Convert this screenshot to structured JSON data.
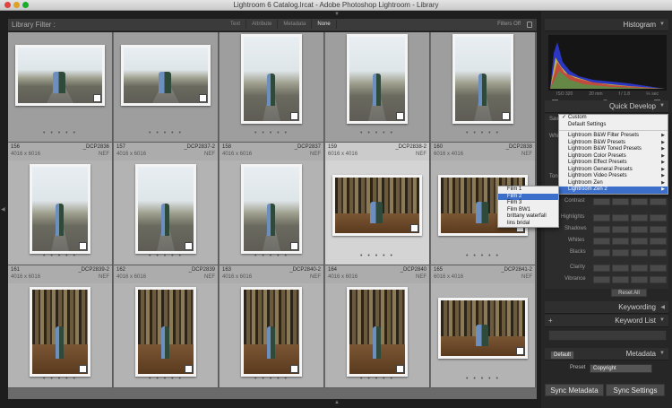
{
  "window": {
    "title": "Lightroom 6 Catalog.lrcat - Adobe Photoshop Lightroom - Library"
  },
  "library_filter": {
    "title": "Library Filter :",
    "tabs": [
      "Text",
      "Attribute",
      "Metadata",
      "None"
    ],
    "active_tab": "None",
    "filters_status": "Filters Off"
  },
  "grid": {
    "cells": [
      {
        "num": "",
        "name": "",
        "dims": "",
        "type": "",
        "photo": "road",
        "orient": "land",
        "style": "dark"
      },
      {
        "num": "",
        "name": "",
        "dims": "",
        "type": "",
        "photo": "road",
        "orient": "land",
        "style": "dark"
      },
      {
        "num": "",
        "name": "",
        "dims": "",
        "type": "",
        "photo": "road",
        "orient": "port",
        "style": "dark"
      },
      {
        "num": "",
        "name": "",
        "dims": "",
        "type": "",
        "photo": "road",
        "orient": "port",
        "style": "dark"
      },
      {
        "num": "",
        "name": "",
        "dims": "",
        "type": "",
        "photo": "road",
        "orient": "port",
        "style": "dark"
      },
      {
        "num": "156",
        "name": "_DCP2836",
        "dims": "4016 x 6016",
        "type": "NEF",
        "photo": "road",
        "orient": "port",
        "style": "light"
      },
      {
        "num": "157",
        "name": "_DCP2837-2",
        "dims": "4016 x 6016",
        "type": "NEF",
        "photo": "road",
        "orient": "port",
        "style": "light"
      },
      {
        "num": "158",
        "name": "_DCP2837",
        "dims": "4016 x 6016",
        "type": "NEF",
        "photo": "road",
        "orient": "port",
        "style": "light"
      },
      {
        "num": "159",
        "name": "_DCP2838-2",
        "dims": "6016 x 4016",
        "type": "NEF",
        "photo": "forest",
        "orient": "land",
        "style": "sel"
      },
      {
        "num": "160",
        "name": "_DCP2838",
        "dims": "6016 x 4016",
        "type": "NEF",
        "photo": "forest",
        "orient": "land",
        "style": "light"
      },
      {
        "num": "161",
        "name": "_DCP2839-2",
        "dims": "4016 x 6016",
        "type": "NEF",
        "photo": "forest",
        "orient": "port",
        "style": "light"
      },
      {
        "num": "162",
        "name": "_DCP2839",
        "dims": "4016 x 6016",
        "type": "NEF",
        "photo": "forest",
        "orient": "port",
        "style": "light"
      },
      {
        "num": "163",
        "name": "_DCP2840-2",
        "dims": "4016 x 6016",
        "type": "NEF",
        "photo": "forest",
        "orient": "port",
        "style": "light"
      },
      {
        "num": "164",
        "name": "_DCP2840",
        "dims": "4016 x 6016",
        "type": "NEF",
        "photo": "forest",
        "orient": "port",
        "style": "light"
      },
      {
        "num": "165",
        "name": "_DCP2841-2",
        "dims": "6016 x 4016",
        "type": "NEF",
        "photo": "forest",
        "orient": "land",
        "style": "light"
      }
    ]
  },
  "right_panel": {
    "histogram": {
      "title": "Histogram",
      "iso": "ISO 320",
      "focal": "20 mm",
      "aperture": "f / 1.8",
      "shutter": "⅕ sec"
    },
    "quick_develop": {
      "title": "Quick Develop",
      "saved_preset_label": "Sav",
      "white_balance_label": "Whi",
      "tone_label": "Ton",
      "rows": [
        "Contrast",
        "Highlights",
        "Shadows",
        "Whites",
        "Blacks",
        "Clarity",
        "Vibrance"
      ],
      "reset_label": "Reset All"
    },
    "keywording": {
      "title": "Keywording"
    },
    "keyword_list": {
      "title": "Keyword List"
    },
    "metadata": {
      "title": "Metadata",
      "default_label": "Default",
      "preset_label": "Preset",
      "preset_value": "Copyright"
    },
    "buttons": {
      "sync_metadata": "Sync Metadata",
      "sync_settings": "Sync Settings"
    }
  },
  "preset_menu": {
    "items": [
      {
        "label": "Custom",
        "checked": true,
        "submenu": false
      },
      {
        "label": "Default Settings",
        "checked": false,
        "submenu": false
      },
      {
        "sep": true
      },
      {
        "label": "Lightroom B&W Filter Presets",
        "submenu": true
      },
      {
        "label": "Lightroom B&W Presets",
        "submenu": true
      },
      {
        "label": "Lightroom B&W Toned Presets",
        "submenu": true
      },
      {
        "label": "Lightroom Color Presets",
        "submenu": true
      },
      {
        "label": "Lightroom Effect Presets",
        "submenu": true
      },
      {
        "label": "Lightroom General Presets",
        "submenu": true
      },
      {
        "label": "Lightroom Video Presets",
        "submenu": true
      },
      {
        "label": "Lightroom Zen",
        "submenu": true
      },
      {
        "label": "Lightroom Zen 2",
        "submenu": true,
        "highlighted": true
      }
    ]
  },
  "submenu": {
    "items": [
      {
        "label": "Film 1"
      },
      {
        "label": "Film 2",
        "highlighted": true
      },
      {
        "label": "Film 3"
      },
      {
        "label": "Film BW1"
      },
      {
        "label": "brittany waterfall"
      },
      {
        "label": "lins bridal"
      }
    ]
  },
  "colors": {
    "highlight": "#3b6fc9",
    "panel_bg": "#262626",
    "grid_bg": "#6a6a6a"
  }
}
